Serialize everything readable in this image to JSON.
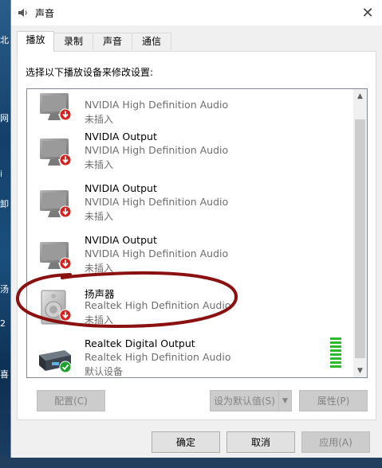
{
  "window": {
    "title": "声音",
    "icon": "speaker-icon",
    "close_glyph": "✕"
  },
  "tabs": [
    {
      "label": "播放",
      "active": true
    },
    {
      "label": "录制",
      "active": false
    },
    {
      "label": "声音",
      "active": false
    },
    {
      "label": "通信",
      "active": false
    }
  ],
  "instruction": "选择以下播放设备来修改设置:",
  "devices": [
    {
      "name": "",
      "driver": "NVIDIA High Definition Audio",
      "state": "未插入",
      "icon": "monitor-icon",
      "status": "unplugged-icon"
    },
    {
      "name": "NVIDIA Output",
      "driver": "NVIDIA High Definition Audio",
      "state": "未插入",
      "icon": "monitor-icon",
      "status": "unplugged-icon"
    },
    {
      "name": "NVIDIA Output",
      "driver": "NVIDIA High Definition Audio",
      "state": "未插入",
      "icon": "monitor-icon",
      "status": "unplugged-icon"
    },
    {
      "name": "NVIDIA Output",
      "driver": "NVIDIA High Definition Audio",
      "state": "未插入",
      "icon": "monitor-icon",
      "status": "unplugged-icon"
    },
    {
      "name": "扬声器",
      "driver": "Realtek High Definition Audio",
      "state": "未插入",
      "icon": "speaker-device-icon",
      "status": "unplugged-icon"
    },
    {
      "name": "Realtek Digital Output",
      "driver": "Realtek High Definition Audio",
      "state": "默认设备",
      "icon": "digital-output-icon",
      "status": "default-check-icon"
    }
  ],
  "level_meter": {
    "segments": 8,
    "lit": 8,
    "color": "#2eb82e"
  },
  "actions": {
    "configure": "配置(C)",
    "set_default": "设为默认值(S)",
    "properties": "属性(P)"
  },
  "footer": {
    "ok": "确定",
    "cancel": "取消",
    "apply": "应用(A)"
  },
  "desktop_fragments": [
    "北",
    "网",
    "i",
    "卸",
    "汤",
    "2",
    "喜"
  ],
  "colors": {
    "unplugged": "#d6221e",
    "default_check": "#1ea02e",
    "annotation": "#8b1111"
  }
}
